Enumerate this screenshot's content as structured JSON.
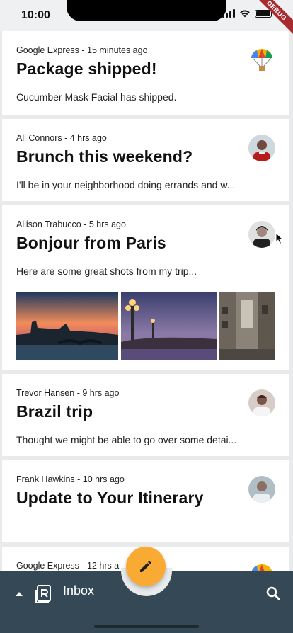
{
  "status_bar": {
    "time": "10:00",
    "debug_label": "DEBUG"
  },
  "emails": [
    {
      "sender": "Google Express",
      "time": "15 minutes ago",
      "subject": "Package shipped!",
      "preview": "Cucumber Mask Facial has shipped.",
      "avatar": "parachute-icon"
    },
    {
      "sender": "Ali Connors",
      "time": "4 hrs ago",
      "subject": "Brunch this weekend?",
      "preview": "I'll be in your neighborhood doing errands and w...",
      "avatar": "person-avatar"
    },
    {
      "sender": "Allison Trabucco",
      "time": "5 hrs ago",
      "subject": "Bonjour from Paris",
      "preview": "Here are some great shots from my trip...",
      "avatar": "person-avatar",
      "photos": [
        "paris-photo-1",
        "paris-photo-2",
        "paris-photo-3"
      ]
    },
    {
      "sender": "Trevor Hansen",
      "time": "9 hrs ago",
      "subject": "Brazil trip",
      "preview": "Thought we might be able to go over some detai...",
      "avatar": "person-avatar"
    },
    {
      "sender": "Frank Hawkins",
      "time": "10 hrs ago",
      "subject": "Update to Your Itinerary",
      "preview": "",
      "avatar": "person-avatar"
    },
    {
      "sender": "Google Express",
      "time": "12 hrs a",
      "subject": "",
      "preview": "",
      "avatar": "parachute-icon"
    }
  ],
  "bottom_bar": {
    "label": "Inbox"
  },
  "colors": {
    "accent": "#f9aa33",
    "bar": "#344955",
    "background": "#e9eaec"
  }
}
